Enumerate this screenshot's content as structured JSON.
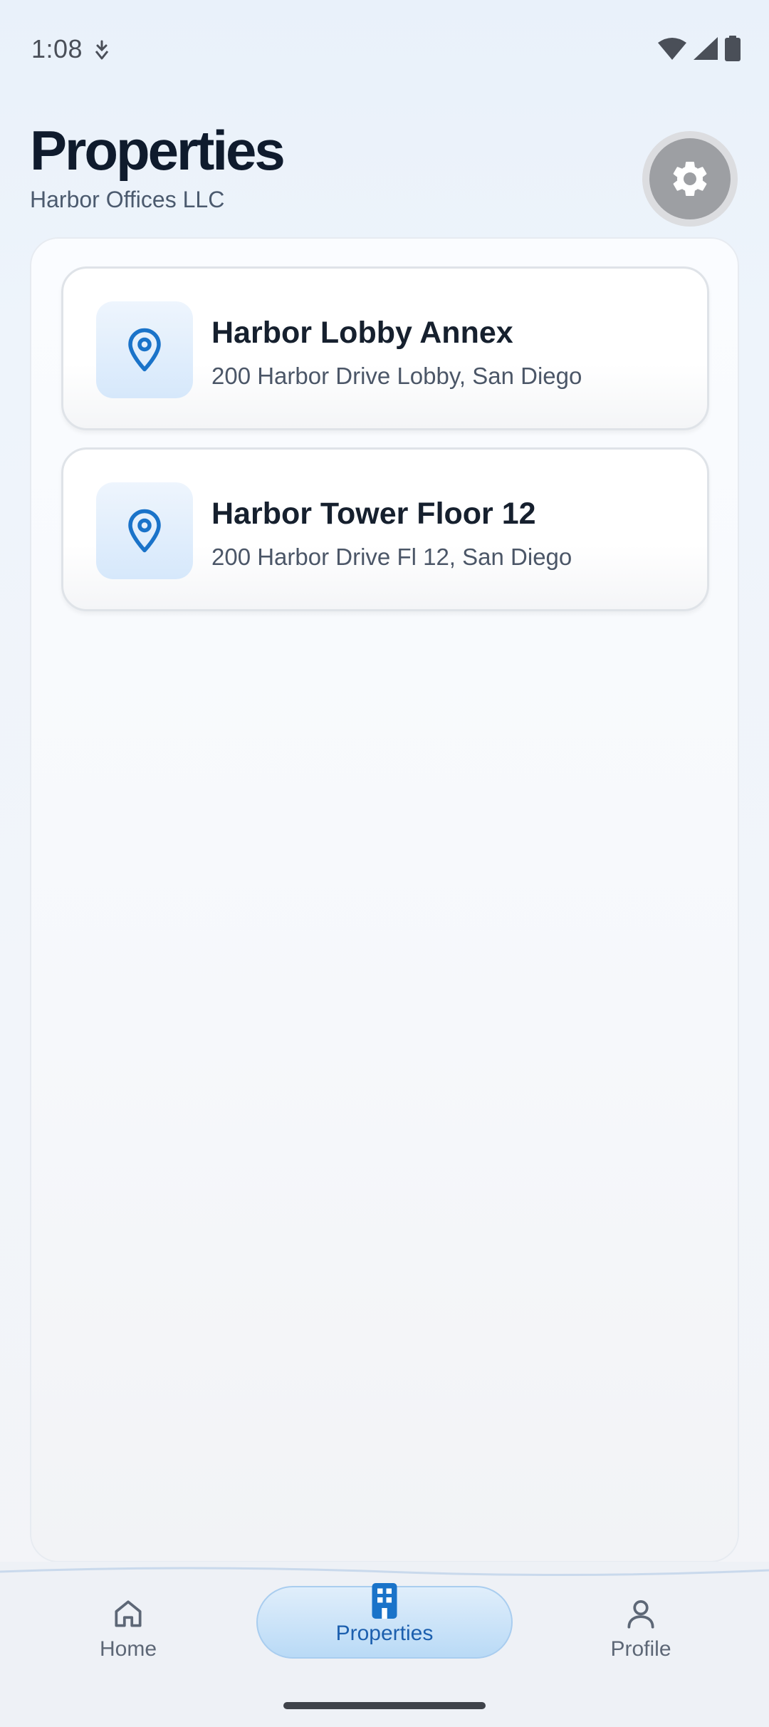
{
  "status_bar": {
    "time": "1:08"
  },
  "header": {
    "title": "Properties",
    "subtitle": "Harbor Offices LLC",
    "settings_icon": "gear-icon"
  },
  "properties": [
    {
      "name": "Harbor Lobby Annex",
      "address": "200 Harbor Drive Lobby, San Diego",
      "icon": "location-pin-icon"
    },
    {
      "name": "Harbor Tower Floor 12",
      "address": "200 Harbor Drive Fl 12, San Diego",
      "icon": "location-pin-icon"
    }
  ],
  "bottom_nav": {
    "items": [
      {
        "label": "Home",
        "icon": "home-icon",
        "active": false
      },
      {
        "label": "Properties",
        "icon": "building-icon",
        "active": true
      },
      {
        "label": "Profile",
        "icon": "person-icon",
        "active": false
      }
    ]
  },
  "colors": {
    "accent": "#1a73c9",
    "title": "#0f1b2d",
    "active_nav_bg": "#c6e1f8"
  }
}
